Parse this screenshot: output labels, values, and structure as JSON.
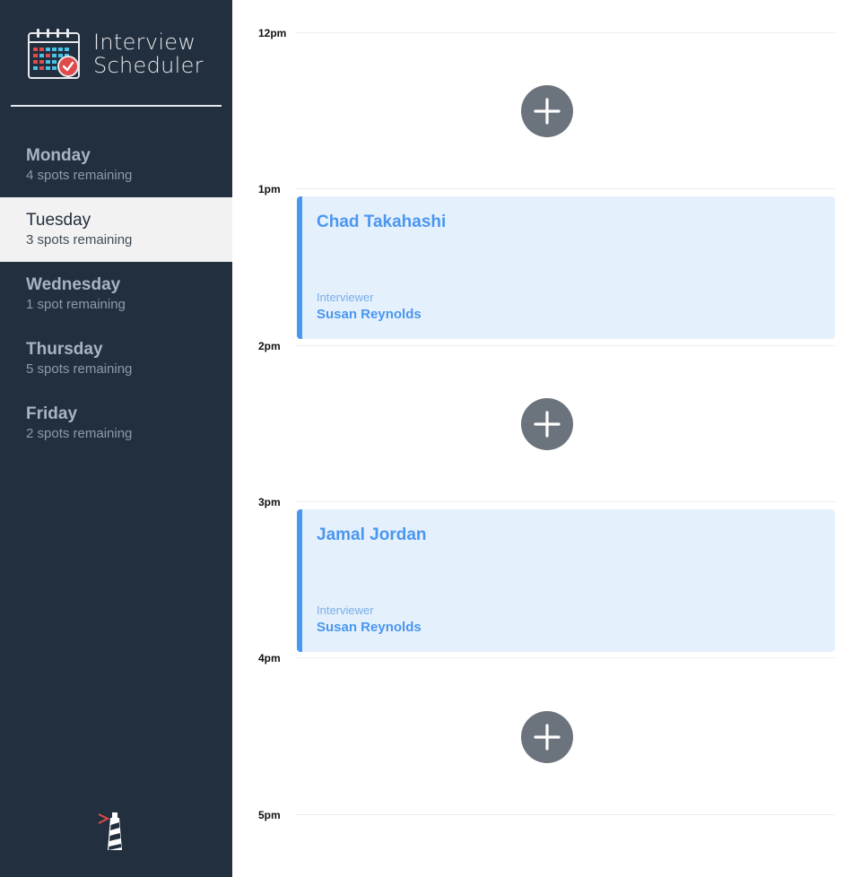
{
  "app": {
    "title_line1": "Interview",
    "title_line2": "Scheduler",
    "logo_icon": "calendar-check-icon",
    "footer_icon": "lighthouse-icon"
  },
  "days": [
    {
      "name": "Monday",
      "spots": "4 spots remaining",
      "selected": false
    },
    {
      "name": "Tuesday",
      "spots": "3 spots remaining",
      "selected": true
    },
    {
      "name": "Wednesday",
      "spots": "1 spot remaining",
      "selected": false
    },
    {
      "name": "Thursday",
      "spots": "5 spots remaining",
      "selected": false
    },
    {
      "name": "Friday",
      "spots": "2 spots remaining",
      "selected": false
    }
  ],
  "schedule": {
    "times": [
      "12pm",
      "1pm",
      "2pm",
      "3pm",
      "4pm",
      "5pm"
    ],
    "appointments": [
      {
        "time": "1pm",
        "student": "Chad Takahashi",
        "interviewer_label": "Interviewer",
        "interviewer": "Susan Reynolds"
      },
      {
        "time": "3pm",
        "student": "Jamal Jordan",
        "interviewer_label": "Interviewer",
        "interviewer": "Susan Reynolds"
      }
    ],
    "empty_slots": [
      "12pm",
      "2pm",
      "4pm"
    ],
    "add_icon": "plus-icon"
  },
  "colors": {
    "sidebar": "#222f3e",
    "accent": "#4a97ef",
    "appointment_bg": "#e5f0fd",
    "add_button": "#6b737c"
  }
}
